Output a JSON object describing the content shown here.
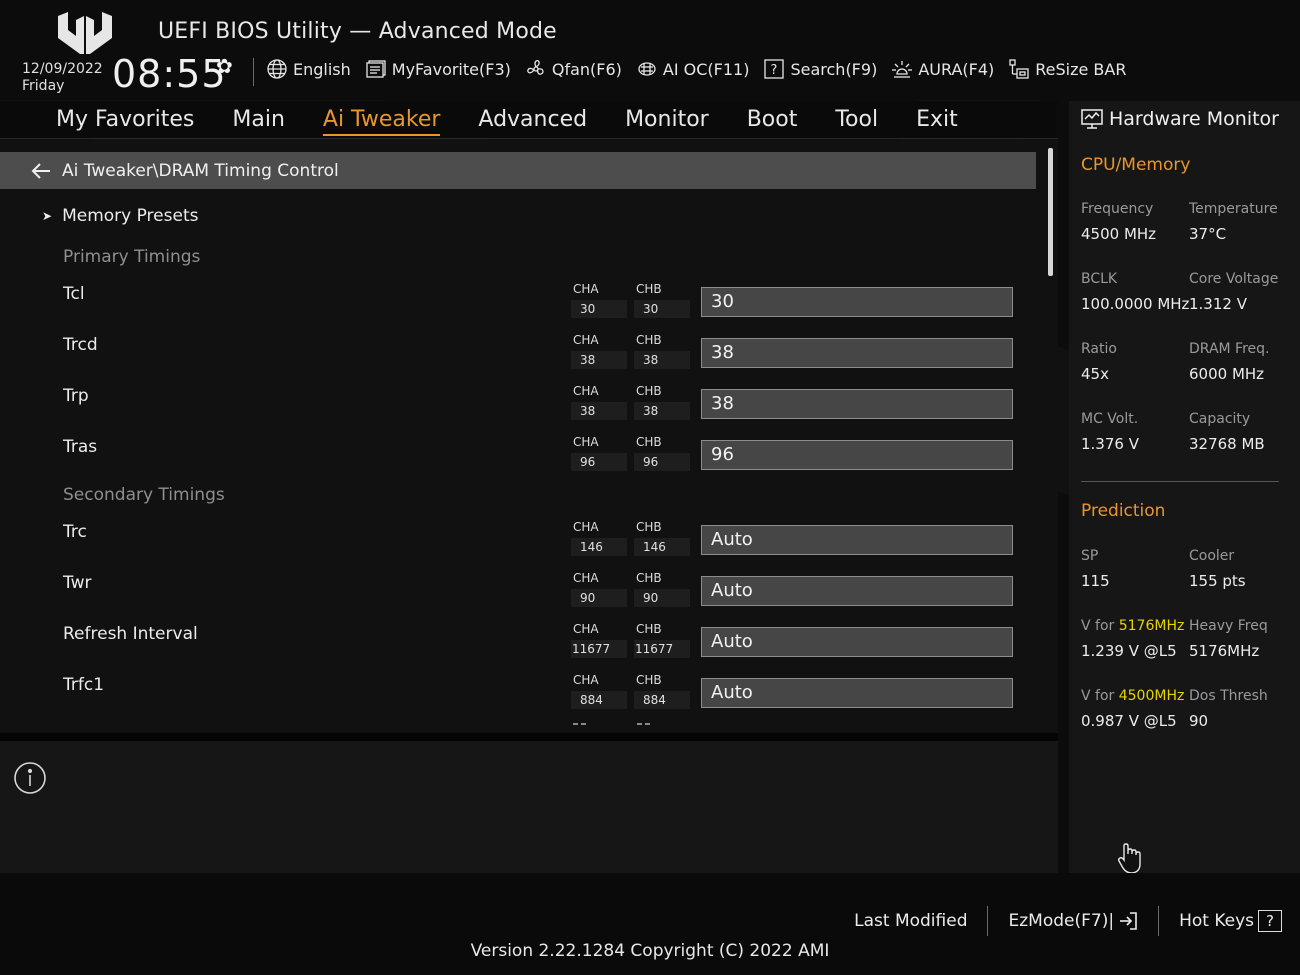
{
  "header": {
    "title": "UEFI BIOS Utility — Advanced Mode",
    "date": "12/09/2022",
    "day": "Friday",
    "time": "08:55",
    "toolbar": [
      {
        "label": "English",
        "icon": "globe-icon"
      },
      {
        "label": "MyFavorite(F3)",
        "icon": "favorite-list-icon"
      },
      {
        "label": "Qfan(F6)",
        "icon": "fan-icon"
      },
      {
        "label": "AI OC(F11)",
        "icon": "ai-chip-icon"
      },
      {
        "label": "Search(F9)",
        "icon": "search-help-icon"
      },
      {
        "label": "AURA(F4)",
        "icon": "aura-light-icon"
      },
      {
        "label": "ReSize BAR",
        "icon": "resize-bar-icon"
      }
    ]
  },
  "nav": {
    "tabs": [
      "My Favorites",
      "Main",
      "Ai Tweaker",
      "Advanced",
      "Monitor",
      "Boot",
      "Tool",
      "Exit"
    ],
    "active": "Ai Tweaker"
  },
  "main": {
    "breadcrumb": "Ai Tweaker\\DRAM Timing Control",
    "presets_label": "Memory Presets",
    "primary_label": "Primary Timings",
    "secondary_label": "Secondary Timings",
    "channel_a_label": "CHA",
    "channel_b_label": "CHB",
    "primary": [
      {
        "name": "Tcl",
        "cha": "30",
        "chb": "30",
        "value": "30"
      },
      {
        "name": "Trcd",
        "cha": "38",
        "chb": "38",
        "value": "38"
      },
      {
        "name": "Trp",
        "cha": "38",
        "chb": "38",
        "value": "38"
      },
      {
        "name": "Tras",
        "cha": "96",
        "chb": "96",
        "value": "96"
      }
    ],
    "secondary": [
      {
        "name": "Trc",
        "cha": "146",
        "chb": "146",
        "value": "Auto"
      },
      {
        "name": "Twr",
        "cha": "90",
        "chb": "90",
        "value": "Auto"
      },
      {
        "name": "Refresh Interval",
        "cha": "11677",
        "chb": "11677",
        "value": "Auto"
      },
      {
        "name": "Trfc1",
        "cha": "884",
        "chb": "884",
        "value": "Auto"
      }
    ]
  },
  "hwmon": {
    "title": "Hardware Monitor",
    "cpu_section": "CPU/Memory",
    "cpu": [
      {
        "label": "Frequency",
        "value": "4500 MHz"
      },
      {
        "label": "Temperature",
        "value": "37°C"
      },
      {
        "label": "BCLK",
        "value": "100.0000 MHz"
      },
      {
        "label": "Core Voltage",
        "value": "1.312 V"
      },
      {
        "label": "Ratio",
        "value": "45x"
      },
      {
        "label": "DRAM Freq.",
        "value": "6000 MHz"
      },
      {
        "label": "MC Volt.",
        "value": "1.376 V"
      },
      {
        "label": "Capacity",
        "value": "32768 MB"
      }
    ],
    "prediction_section": "Prediction",
    "prediction": {
      "sp_label": "SP",
      "sp_value": "115",
      "cooler_label": "Cooler",
      "cooler_value": "155 pts",
      "v1_prefix": "V for ",
      "v1_freq": "5176MHz",
      "v1_value": "1.239 V @L5",
      "heavy_label": "Heavy Freq",
      "heavy_value": "5176MHz",
      "v2_prefix": "V for ",
      "v2_freq": "4500MHz",
      "v2_value": "0.987 V @L5",
      "dos_label": "Dos Thresh",
      "dos_value": "90"
    }
  },
  "footer": {
    "last_modified": "Last Modified",
    "ezmode": "EzMode(F7)|",
    "hotkeys": "Hot Keys",
    "hotkeys_icon_text": "?",
    "version": "Version 2.22.1284 Copyright (C) 2022 AMI"
  },
  "colors": {
    "accent": "#e8972a",
    "highlight": "#e4d400",
    "background": "#0c0c0c",
    "panel": "#161616"
  }
}
